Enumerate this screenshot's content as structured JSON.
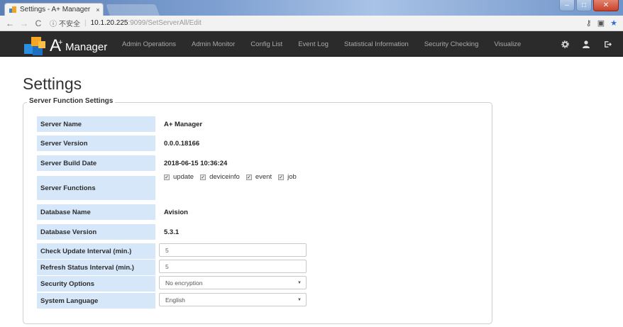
{
  "browser": {
    "tab_title": "Settings - A+ Manager",
    "tab_close": "×",
    "security_label": "不安全",
    "url_host": "10.1.20.225",
    "url_path": ":9099/SetServerAll/Edit"
  },
  "navbar": {
    "brand_letter": "A",
    "brand_plus": "+",
    "brand_word": "Manager",
    "links": [
      "Admin Operations",
      "Admin Monitor",
      "Config List",
      "Event Log",
      "Statistical Information",
      "Security Checking",
      "Visualize"
    ]
  },
  "page": {
    "title": "Settings",
    "legend": "Server Function Settings"
  },
  "settings": {
    "server_name": {
      "label": "Server Name",
      "value": "A+ Manager"
    },
    "server_version": {
      "label": "Server Version",
      "value": "0.0.0.18166"
    },
    "server_build_date": {
      "label": "Server Build Date",
      "value": "2018-06-15 10:36:24"
    },
    "server_functions": {
      "label": "Server Functions",
      "options": [
        "update",
        "deviceinfo",
        "event",
        "job"
      ]
    },
    "database_name": {
      "label": "Database Name",
      "value": "Avision"
    },
    "database_version": {
      "label": "Database Version",
      "value": "5.3.1"
    },
    "check_update_interval": {
      "label": "Check Update Interval (min.)",
      "value": "5"
    },
    "refresh_status_interval": {
      "label": "Refresh Status Interval (min.)",
      "value": "5"
    },
    "security_options": {
      "label": "Security Options",
      "value": "No encryption"
    },
    "system_language": {
      "label": "System Language",
      "value": "English"
    }
  },
  "colors": {
    "navbar_bg": "#2b2b2b",
    "label_bg": "#d6e7f9"
  }
}
